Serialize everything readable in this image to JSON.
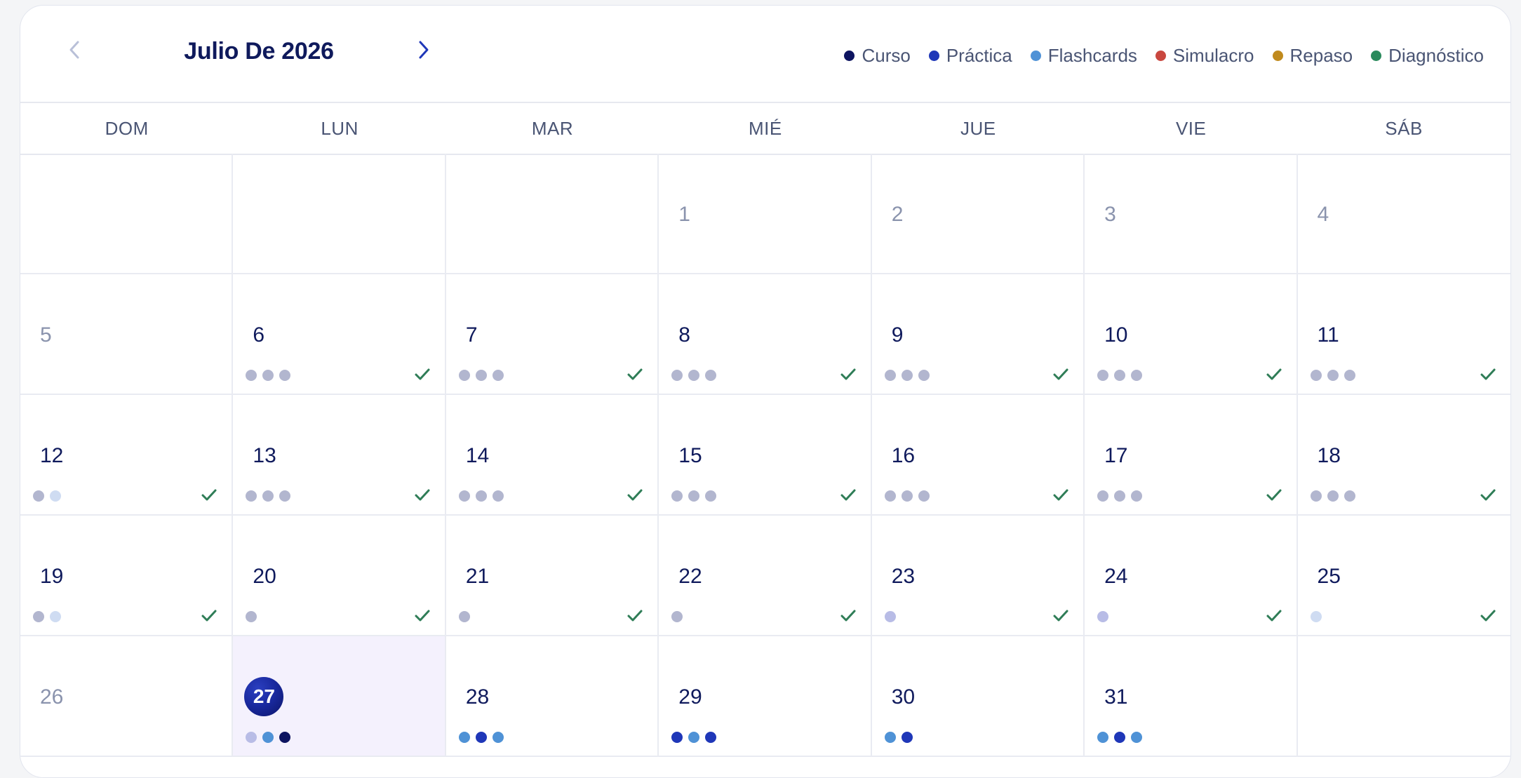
{
  "calendar": {
    "title": "Julio De 2026",
    "prev_icon": "chevron-left-icon",
    "next_icon": "chevron-right-icon"
  },
  "colors": {
    "curso": "#0d1460",
    "practica": "#1f37b8",
    "flashcards": "#4f92d6",
    "simulacro": "#c9473f",
    "repaso": "#c08a1d",
    "diagnostico": "#2a8a5c",
    "done_grey": "#b2b6cf",
    "done_light": "#cfdcf2",
    "done_lilac": "#b8bce6",
    "check": "#2f7d57"
  },
  "legend": [
    {
      "label": "Curso",
      "color": "#0d1460"
    },
    {
      "label": "Práctica",
      "color": "#1f37b8"
    },
    {
      "label": "Flashcards",
      "color": "#4f92d6"
    },
    {
      "label": "Simulacro",
      "color": "#c9473f"
    },
    {
      "label": "Repaso",
      "color": "#c08a1d"
    },
    {
      "label": "Diagnóstico",
      "color": "#2a8a5c"
    }
  ],
  "weekdays": [
    "DOM",
    "LUN",
    "MAR",
    "MIÉ",
    "JUE",
    "VIE",
    "SÁB"
  ],
  "days": [
    {
      "num": ""
    },
    {
      "num": ""
    },
    {
      "num": ""
    },
    {
      "num": "1",
      "muted": true
    },
    {
      "num": "2",
      "muted": true
    },
    {
      "num": "3",
      "muted": true
    },
    {
      "num": "4",
      "muted": true
    },
    {
      "num": "5",
      "muted": true
    },
    {
      "num": "6",
      "dots": [
        "#b2b6cf",
        "#b2b6cf",
        "#b2b6cf"
      ],
      "check": true
    },
    {
      "num": "7",
      "dots": [
        "#b2b6cf",
        "#b2b6cf",
        "#b2b6cf"
      ],
      "check": true
    },
    {
      "num": "8",
      "dots": [
        "#b2b6cf",
        "#b2b6cf",
        "#b2b6cf"
      ],
      "check": true
    },
    {
      "num": "9",
      "dots": [
        "#b2b6cf",
        "#b2b6cf",
        "#b2b6cf"
      ],
      "check": true
    },
    {
      "num": "10",
      "dots": [
        "#b2b6cf",
        "#b2b6cf",
        "#b2b6cf"
      ],
      "check": true
    },
    {
      "num": "11",
      "dots": [
        "#b2b6cf",
        "#b2b6cf",
        "#b2b6cf"
      ],
      "check": true
    },
    {
      "num": "12",
      "dots": [
        "#b2b6cf",
        "#cfdcf2"
      ],
      "check": true
    },
    {
      "num": "13",
      "dots": [
        "#b2b6cf",
        "#b2b6cf",
        "#b2b6cf"
      ],
      "check": true
    },
    {
      "num": "14",
      "dots": [
        "#b2b6cf",
        "#b2b6cf",
        "#b2b6cf"
      ],
      "check": true
    },
    {
      "num": "15",
      "dots": [
        "#b2b6cf",
        "#b2b6cf",
        "#b2b6cf"
      ],
      "check": true
    },
    {
      "num": "16",
      "dots": [
        "#b2b6cf",
        "#b2b6cf",
        "#b2b6cf"
      ],
      "check": true
    },
    {
      "num": "17",
      "dots": [
        "#b2b6cf",
        "#b2b6cf",
        "#b2b6cf"
      ],
      "check": true
    },
    {
      "num": "18",
      "dots": [
        "#b2b6cf",
        "#b2b6cf",
        "#b2b6cf"
      ],
      "check": true
    },
    {
      "num": "19",
      "dots": [
        "#b2b6cf",
        "#cfdcf2"
      ],
      "check": true
    },
    {
      "num": "20",
      "dots": [
        "#b2b6cf"
      ],
      "check": true
    },
    {
      "num": "21",
      "dots": [
        "#b2b6cf"
      ],
      "check": true
    },
    {
      "num": "22",
      "dots": [
        "#b2b6cf"
      ],
      "check": true
    },
    {
      "num": "23",
      "dots": [
        "#b8bce6"
      ],
      "check": true
    },
    {
      "num": "24",
      "dots": [
        "#b8bce6"
      ],
      "check": true
    },
    {
      "num": "25",
      "dots": [
        "#cfdcf2"
      ],
      "check": true
    },
    {
      "num": "26",
      "muted": true
    },
    {
      "num": "27",
      "today": true,
      "dots": [
        "#b8bce6",
        "#4f92d6",
        "#0d1460"
      ]
    },
    {
      "num": "28",
      "dots": [
        "#4f92d6",
        "#1f37b8",
        "#4f92d6"
      ]
    },
    {
      "num": "29",
      "dots": [
        "#1f37b8",
        "#4f92d6",
        "#1f37b8"
      ]
    },
    {
      "num": "30",
      "dots": [
        "#4f92d6",
        "#1f37b8"
      ]
    },
    {
      "num": "31",
      "dots": [
        "#4f92d6",
        "#1f37b8",
        "#4f92d6"
      ]
    },
    {
      "num": ""
    }
  ]
}
